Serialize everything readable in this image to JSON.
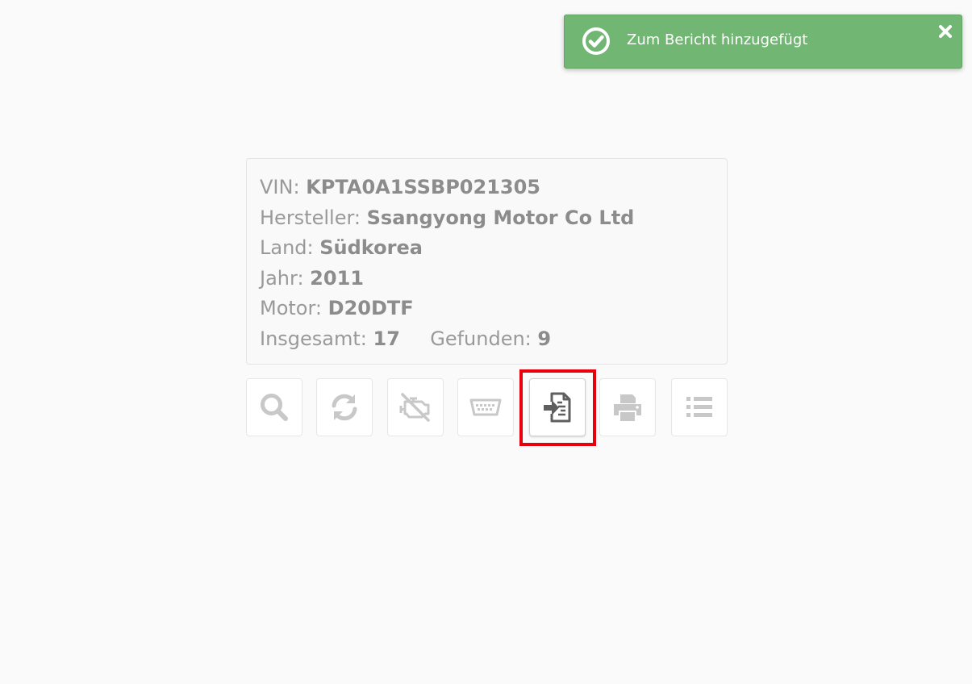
{
  "toast": {
    "message": "Zum Bericht hinzugefügt",
    "icon": "check-circle-icon",
    "close_icon": "close-icon",
    "color": "#72b673"
  },
  "vehicle": {
    "vin_label": "VIN:",
    "vin_value": "KPTA0A1SSBP021305",
    "manufacturer_label": "Hersteller:",
    "manufacturer_value": "Ssangyong Motor Co Ltd",
    "country_label": "Land:",
    "country_value": "Südkorea",
    "year_label": "Jahr:",
    "year_value": "2011",
    "engine_label": "Motor:",
    "engine_value": "D20DTF",
    "total_label": "Insgesamt:",
    "total_value": "17",
    "found_label": "Gefunden:",
    "found_value": "9"
  },
  "toolbar": {
    "buttons": [
      {
        "name": "search-button",
        "icon": "search-icon"
      },
      {
        "name": "refresh-button",
        "icon": "refresh-icon"
      },
      {
        "name": "engine-off-button",
        "icon": "engine-off-icon"
      },
      {
        "name": "obd-connector-button",
        "icon": "obd-connector-icon"
      },
      {
        "name": "add-to-report-button",
        "icon": "file-import-icon",
        "highlighted": true
      },
      {
        "name": "print-button",
        "icon": "print-icon"
      },
      {
        "name": "list-button",
        "icon": "list-icon"
      }
    ],
    "highlight_color": "#e8000c"
  }
}
